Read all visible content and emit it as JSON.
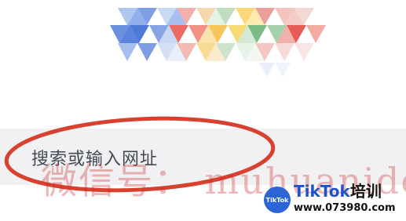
{
  "search": {
    "placeholder": "搜索或输入网址"
  },
  "overlay": {
    "watermark": "微信号： muhuanidc"
  },
  "brand": {
    "badge": "TikTok",
    "name": "TikTok",
    "name_cn": "培训",
    "url": "www.073980.com"
  },
  "colors": {
    "annotation_red": "#d8412f",
    "brand_blue": "#1f54c9",
    "search_bg": "#f1f1f3"
  }
}
